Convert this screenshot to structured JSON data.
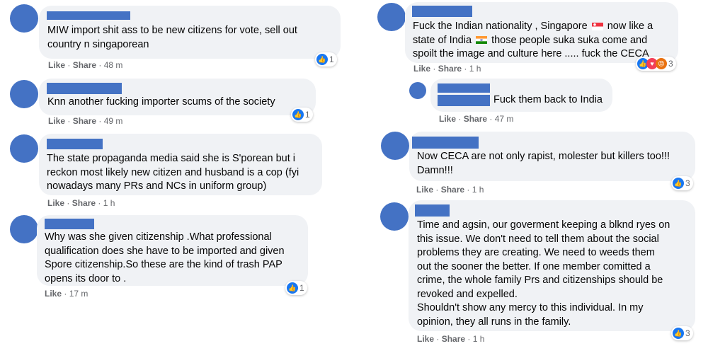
{
  "left": [
    {
      "text": "MIW import shit ass to be new citizens for vote, sell out\ncountry n singaporean",
      "like": "Like",
      "share": "Share",
      "time": "48 m",
      "reactions": "1",
      "sep": "·"
    },
    {
      "text": "Knn another fucking importer scums of the society",
      "like": "Like",
      "share": "Share",
      "time": "49 m",
      "reactions": "1",
      "sep": "·"
    },
    {
      "text": "The state propaganda media said she is S'porean but i\nreckon most likely new citizen and husband is a cop (fyi\nnowadays many PRs and NCs in uniform group)",
      "like": "Like",
      "share": "Share",
      "time": "1 h",
      "reactions": "",
      "sep": "·"
    },
    {
      "text": "Why was she given citizenship .What professional\nqualification does she have to be imported and given\nSpore citizenship.So these are the kind of trash PAP\nopens its door to .",
      "like": "Like",
      "share": "",
      "time": "17 m",
      "reactions": "1",
      "sep": "·"
    }
  ],
  "right": [
    {
      "line1a": "Fuck the Indian nationality , Singapore",
      "line1b": "now like a",
      "line2a": "state of India",
      "line2b": "those people suka suka come and",
      "line3": "spoilt the image and culture here ..... fuck the CECA",
      "like": "Like",
      "share": "Share",
      "time": "1 h",
      "reactions": "3",
      "sep": "·"
    },
    {
      "text": "Fuck them back to India",
      "like": "Like",
      "share": "Share",
      "time": "47 m",
      "reactions": "",
      "sep": "·"
    },
    {
      "text": "Now CECA are not only rapist, molester but killers too!!!\nDamn!!!",
      "like": "Like",
      "share": "Share",
      "time": "1 h",
      "reactions": "3",
      "sep": "·"
    },
    {
      "text": "Time and agsin, our goverment keeping a blknd ryes on\nthis issue. We don't need to tell them about the social\nproblems they are creating. We need to weeds them\nout the sooner the better. If one member comitted a\ncrime, the whole family Prs and citizenships should be\nrevoked and expelled.\nShouldn't show any mercy to this individual. In my\nopinion, they all runs in the family.",
      "like": "Like",
      "share": "Share",
      "time": "1 h",
      "reactions": "3",
      "sep": "·"
    }
  ],
  "colors": {
    "avatar": "#4472c4",
    "bubble": "#f0f2f5",
    "like": "#1877f2",
    "meta": "#65676b"
  }
}
